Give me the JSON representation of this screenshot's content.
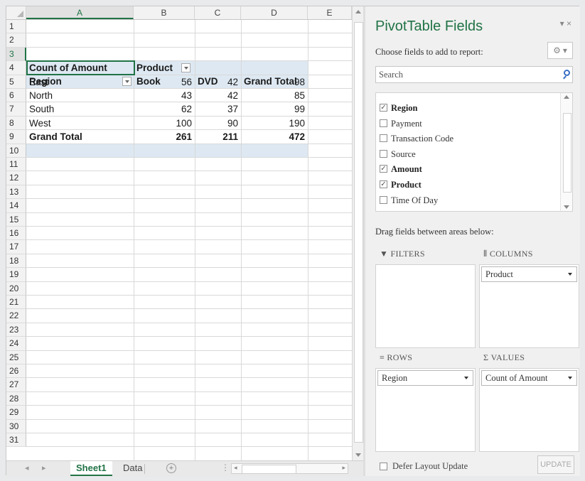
{
  "columns": [
    "A",
    "B",
    "C",
    "D",
    "E"
  ],
  "rows": [
    "1",
    "2",
    "3",
    "4",
    "5",
    "6",
    "7",
    "8",
    "9",
    "10",
    "11",
    "12",
    "13",
    "14",
    "15",
    "16",
    "17",
    "18",
    "19",
    "20",
    "21",
    "22",
    "23",
    "24",
    "25",
    "26",
    "27",
    "28",
    "29",
    "30",
    "31"
  ],
  "pivot": {
    "corner_label": "Count of Amount",
    "column_field": "Product",
    "row_field": "Region",
    "headers": [
      "Book",
      "DVD",
      "Grand Total"
    ],
    "data_rows": [
      {
        "label": "East",
        "values": [
          "56",
          "42",
          "98"
        ]
      },
      {
        "label": "North",
        "values": [
          "43",
          "42",
          "85"
        ]
      },
      {
        "label": "South",
        "values": [
          "62",
          "37",
          "99"
        ]
      },
      {
        "label": "West",
        "values": [
          "100",
          "90",
          "190"
        ]
      }
    ],
    "total_row": {
      "label": "Grand Total",
      "values": [
        "261",
        "211",
        "472"
      ]
    }
  },
  "tabs": {
    "sheet1": "Sheet1",
    "data": "Data",
    "add": "+"
  },
  "pane": {
    "title": "PivotTable Fields",
    "close": "▾ ×",
    "subtitle": "Choose fields to add to report:",
    "gear": "⚙ ▾",
    "search_placeholder": "Search",
    "fields": [
      {
        "name": "Region",
        "checked": true
      },
      {
        "name": "Payment",
        "checked": false
      },
      {
        "name": "Transaction Code",
        "checked": false
      },
      {
        "name": "Source",
        "checked": false
      },
      {
        "name": "Amount",
        "checked": true
      },
      {
        "name": "Product",
        "checked": true
      },
      {
        "name": "Time Of Day",
        "checked": false
      }
    ],
    "drag_label": "Drag fields between areas below:",
    "areas": {
      "filters": {
        "title": "FILTERS",
        "icon": "▼",
        "items": []
      },
      "columns": {
        "title": "COLUMNS",
        "icon": "⦀",
        "items": [
          "Product"
        ]
      },
      "rows": {
        "title": "ROWS",
        "icon": "≡",
        "items": [
          "Region"
        ]
      },
      "values": {
        "title": "VALUES",
        "icon": "Σ",
        "items": [
          "Count of Amount"
        ]
      }
    },
    "defer_label": "Defer Layout Update",
    "update_label": "UPDATE"
  },
  "colors": {
    "accent": "#217346",
    "pivot_band": "#dde8f2"
  }
}
